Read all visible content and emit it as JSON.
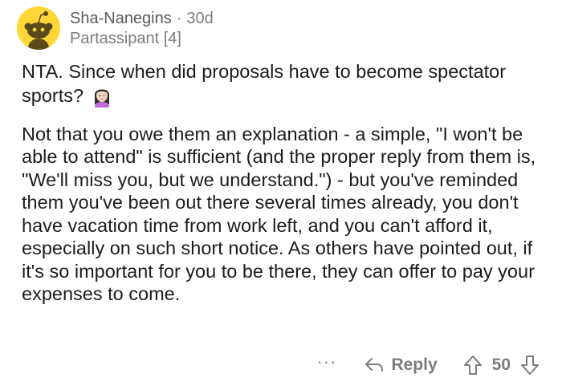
{
  "comment": {
    "username": "Sha-Nanegins",
    "separator": "·",
    "age": "30d",
    "flair": "Partassipant [4]",
    "paragraphs": {
      "p1": "NTA. Since when did proposals have to become spectator sports?",
      "p2": "Not that you owe them an explanation - a simple, \"I won't be able to attend\" is sufficient (and the proper reply from them is, \"We'll miss you, but we understand.\") - but you've reminded them you've been out there several times already, you don't have vacation time from work left, and you can't afford it, especially on such short notice. As others have pointed out, if it's so important for you to be there, they can offer to pay your expenses to come."
    },
    "emoji": "woman-facepalming-icon"
  },
  "actions": {
    "more": "···",
    "reply_label": "Reply",
    "score": "50"
  },
  "colors": {
    "avatar_bg": "#FFD635",
    "text": "#1c1c1c",
    "muted": "#7c7c7c"
  }
}
